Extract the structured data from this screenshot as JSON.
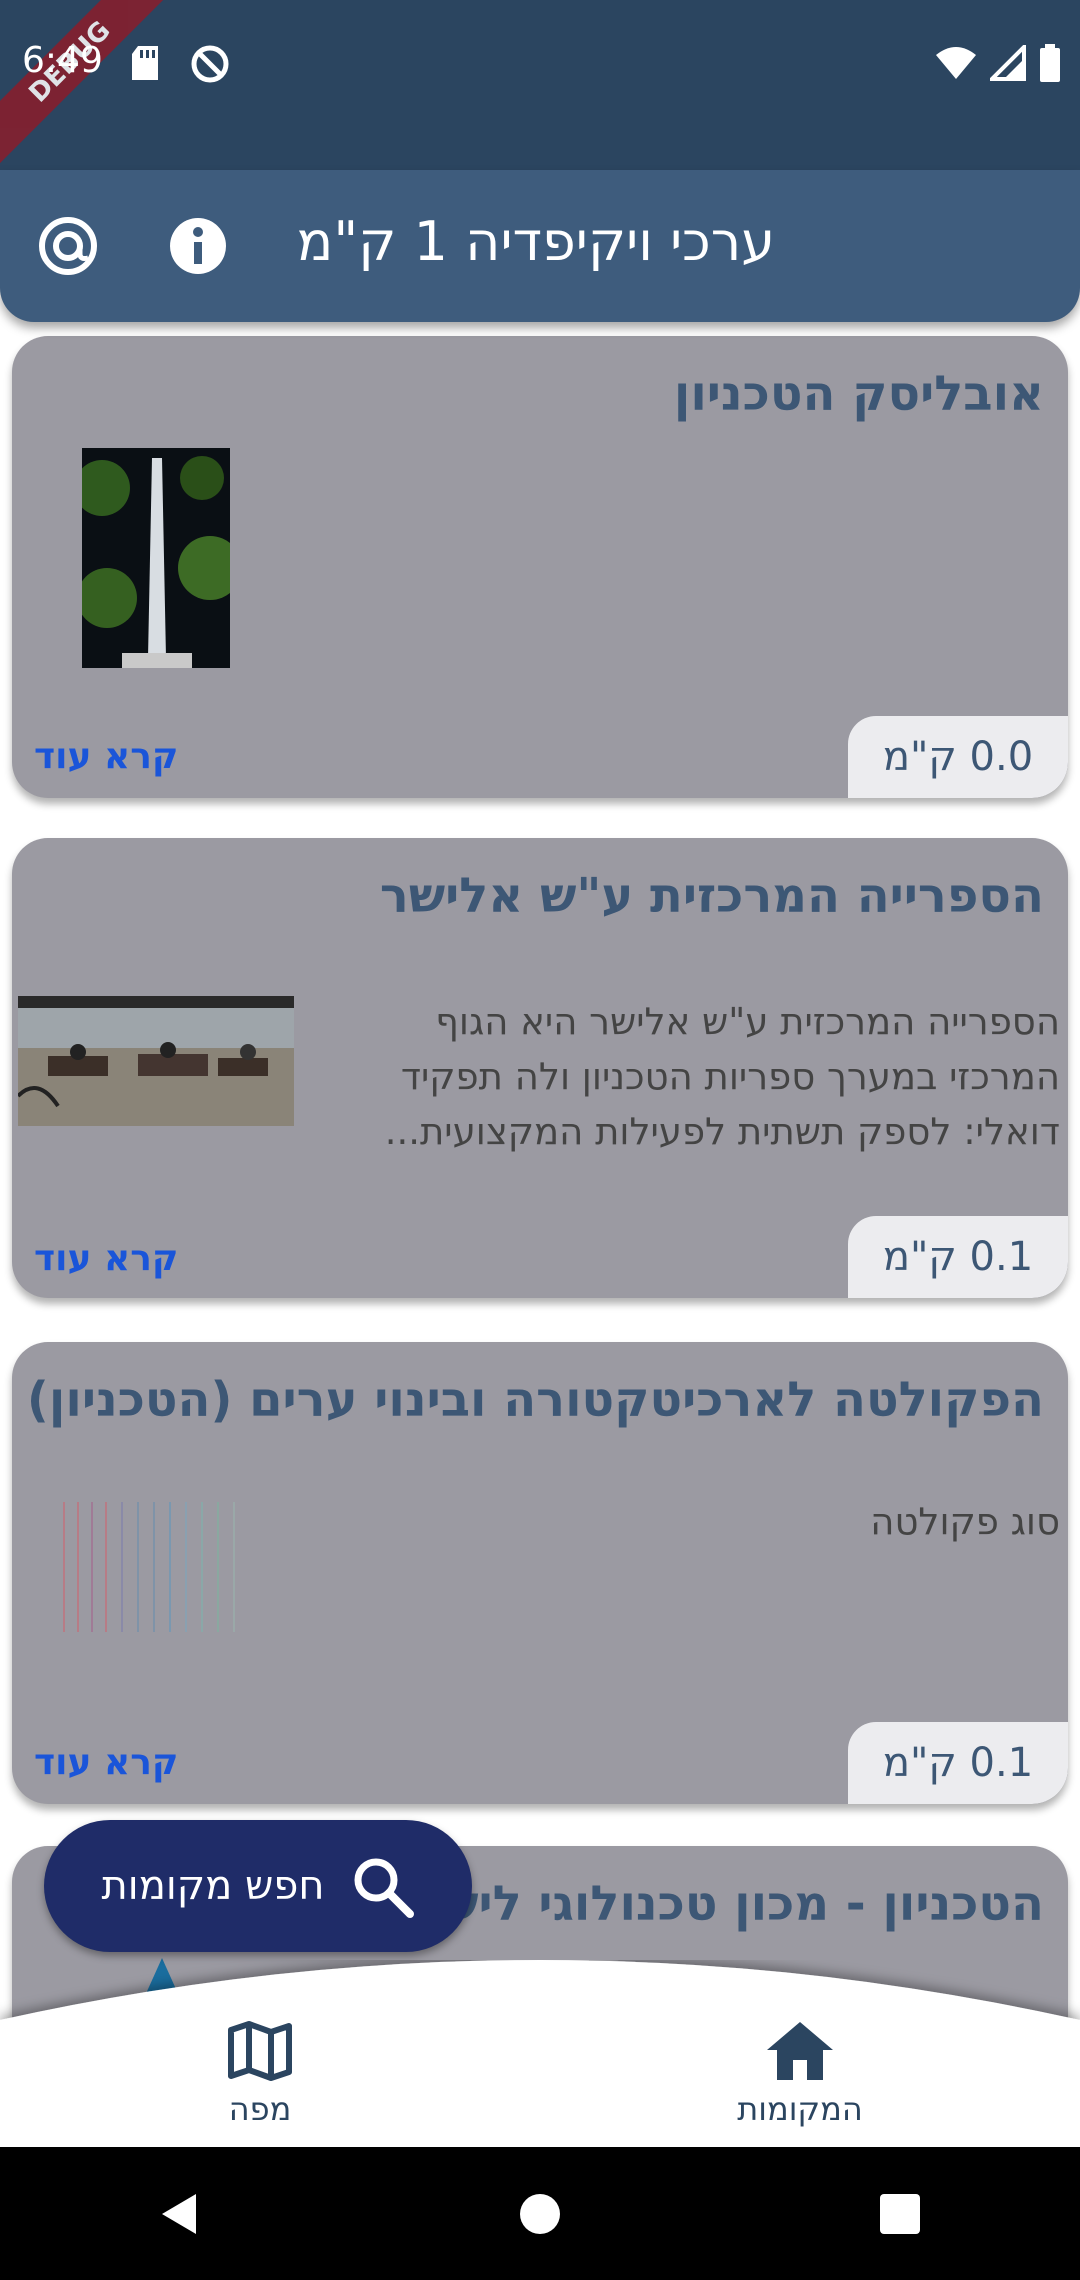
{
  "status_bar": {
    "time": "6:49",
    "debug_label": "DEBUG"
  },
  "app_bar": {
    "title": "ערכי ויקיפדיה 1 ק\"מ"
  },
  "cards": [
    {
      "title": "אובליסק הטכניון",
      "description": "",
      "read_more": "קרא עוד",
      "distance": "0.0 ק\"מ"
    },
    {
      "title": "הספרייה המרכזית ע\"ש אלישר",
      "description": "הספרייה המרכזית ע\"ש אלישר היא הגוף המרכזי במערך ספריות הטכניון ולה תפקיד דואלי: לספק תשתית לפעילות המקצועית...",
      "read_more": "קרא עוד",
      "distance": "0.1 ק\"מ"
    },
    {
      "title": "הפקולטה לארכיטקטורה ובינוי ערים (הטכניון)",
      "description": "סוג פקולטה",
      "read_more": "קרא עוד",
      "distance": "0.1 ק\"מ"
    },
    {
      "title": "הטכניון - מכון טכנולוגי לישראל"
    }
  ],
  "fab": {
    "label": "חפש מקומות",
    "icon": "search-icon"
  },
  "bottom_nav": {
    "map_label": "מפה",
    "places_label": "המקומות"
  },
  "colors": {
    "status_bar": "#2b4560",
    "app_bar": "#3e5c7d",
    "card": "#9b9aa2",
    "title": "#3d5775",
    "link": "#1a55d9",
    "fab": "#1f2c68"
  }
}
